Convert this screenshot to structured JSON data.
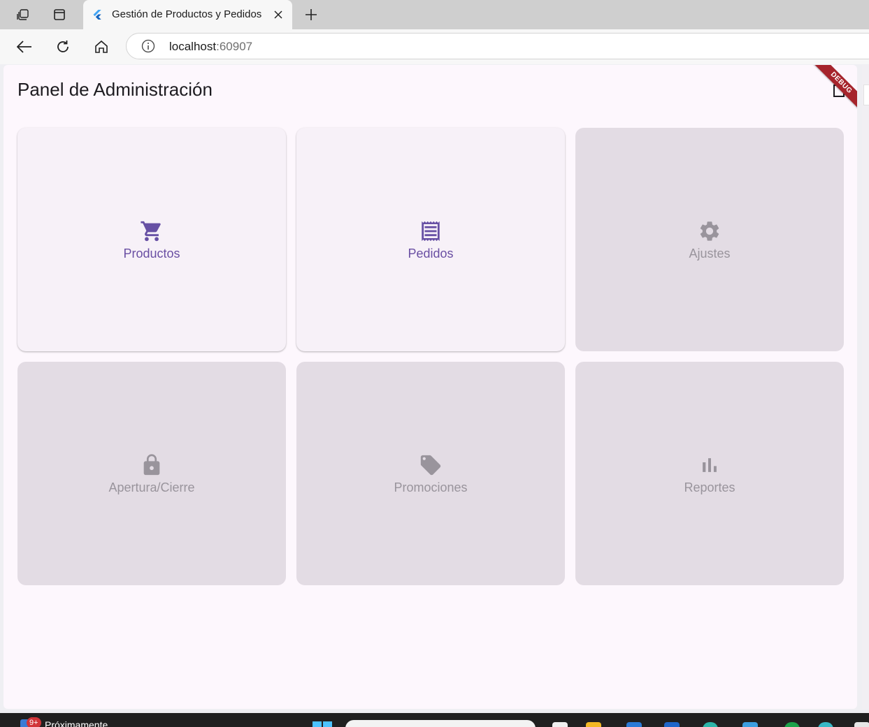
{
  "browser": {
    "tab_title": "Gestión de Productos y Pedidos",
    "url_host": "localhost",
    "url_port": ":60907"
  },
  "app": {
    "title": "Panel de Administración",
    "debug_banner": "DEBUG",
    "accent_color": "#6750a4",
    "disabled_color": "#99949c"
  },
  "cards": [
    {
      "label": "Productos",
      "icon": "shopping-cart-icon",
      "enabled": true
    },
    {
      "label": "Pedidos",
      "icon": "receipt-icon",
      "enabled": true
    },
    {
      "label": "Ajustes",
      "icon": "settings-icon",
      "enabled": false
    },
    {
      "label": "Apertura/Cierre",
      "icon": "lock-icon",
      "enabled": false
    },
    {
      "label": "Promociones",
      "icon": "tag-icon",
      "enabled": false
    },
    {
      "label": "Reportes",
      "icon": "bar-chart-icon",
      "enabled": false
    }
  ],
  "taskbar": {
    "badge": "9+",
    "weather_text": "Próximamente"
  }
}
